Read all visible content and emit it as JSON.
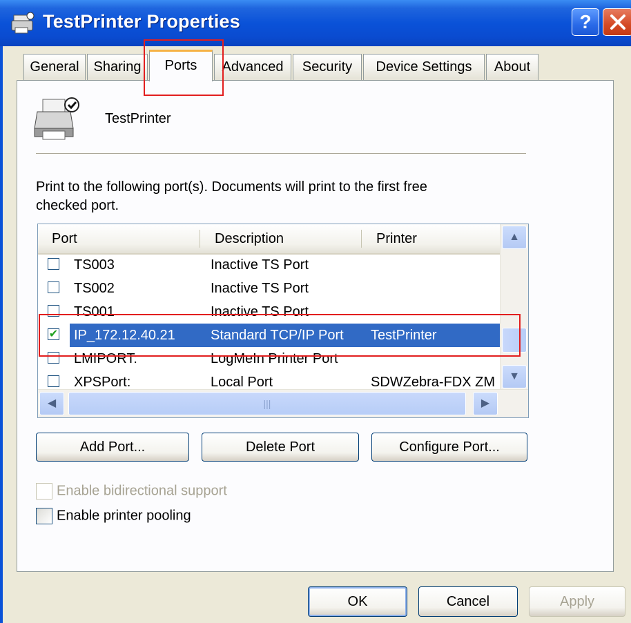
{
  "window": {
    "title": "TestPrinter Properties"
  },
  "tabs": [
    {
      "label": "General"
    },
    {
      "label": "Sharing"
    },
    {
      "label": "Ports"
    },
    {
      "label": "Advanced"
    },
    {
      "label": "Security"
    },
    {
      "label": "Device Settings"
    },
    {
      "label": "About"
    }
  ],
  "printer": {
    "name": "TestPrinter"
  },
  "instructions": "Print to the following port(s). Documents will print to the first free checked port.",
  "ports_list": {
    "columns": [
      "Port",
      "Description",
      "Printer"
    ],
    "rows": [
      {
        "port": "TS003",
        "description": "Inactive TS Port",
        "printer": "",
        "checked": false
      },
      {
        "port": "TS002",
        "description": "Inactive TS Port",
        "printer": "",
        "checked": false
      },
      {
        "port": "TS001",
        "description": "Inactive TS Port",
        "printer": "",
        "checked": false
      },
      {
        "port": "IP_172.12.40.21",
        "description": "Standard TCP/IP Port",
        "printer": "TestPrinter",
        "checked": true
      },
      {
        "port": "LMIPORT:",
        "description": "LogMeIn Printer Port",
        "printer": "",
        "checked": false
      },
      {
        "port": "XPSPort:",
        "description": "Local Port",
        "printer": "SDWZebra-FDX ZM",
        "checked": false
      }
    ]
  },
  "buttons": {
    "add_port": "Add Port...",
    "delete_port": "Delete Port",
    "configure_port": "Configure Port...",
    "ok": "OK",
    "cancel": "Cancel",
    "apply": "Apply"
  },
  "options": {
    "bidirectional": "Enable bidirectional support",
    "pooling": "Enable printer pooling"
  },
  "colors": {
    "titlebar": "#0a52d8",
    "selection": "#316ac5",
    "highlight_annotation": "#e21e1e"
  }
}
